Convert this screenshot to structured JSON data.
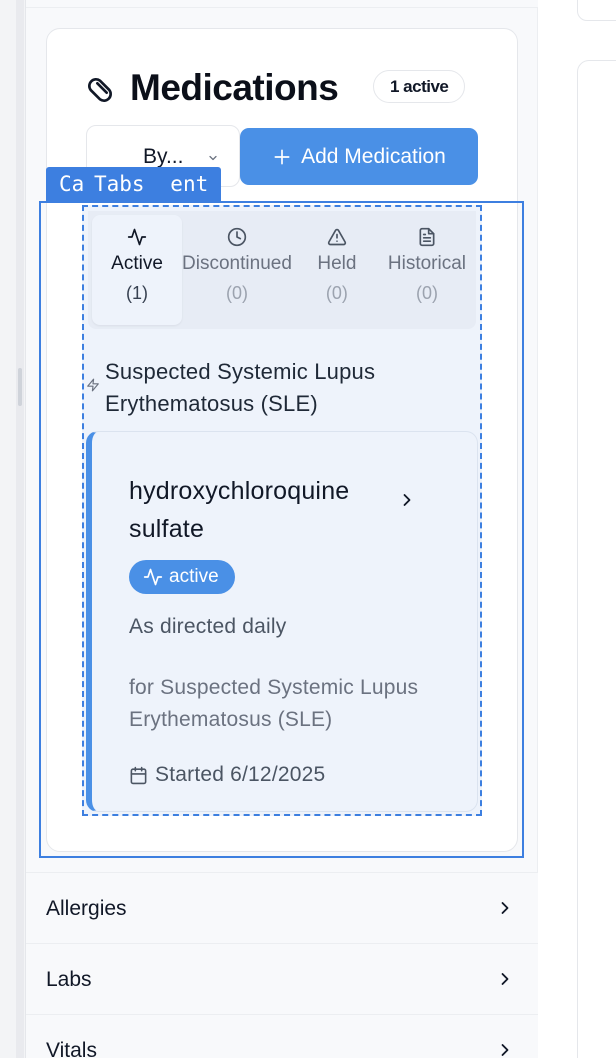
{
  "medications_card": {
    "title": "Medications",
    "active_badge": "1 active",
    "sort_select_value": "By...",
    "add_button_label": "Add Medication"
  },
  "dev_overlay": {
    "label_back": "Ca",
    "label_front": "Tabs",
    "label_tail": "ent"
  },
  "tabs": [
    {
      "label": "Active",
      "count": "(1)",
      "icon": "activity-icon",
      "selected": true
    },
    {
      "label": "Discontinued",
      "count": "(0)",
      "icon": "clock-icon",
      "selected": false
    },
    {
      "label": "Held",
      "count": "(0)",
      "icon": "warning-triangle-icon",
      "selected": false
    },
    {
      "label": "Historical",
      "count": "(0)",
      "icon": "document-icon",
      "selected": false
    }
  ],
  "diagnosis_group": {
    "label": "Suspected Systemic Lupus Erythematosus (SLE)",
    "icon": "bolt-icon"
  },
  "medication": {
    "name": "hydroxychloroquine sulfate",
    "status": "active",
    "dose": "As directed daily",
    "indication": "for Suspected Systemic Lupus Erythematosus (SLE)",
    "started": "Started 6/12/2025"
  },
  "sections": [
    {
      "label": "Allergies"
    },
    {
      "label": "Labs"
    },
    {
      "label": "Vitals"
    }
  ],
  "colors": {
    "accent": "#4a90e6",
    "dev_outline": "#3d7fe0",
    "card_bg": "#eef3fb"
  }
}
